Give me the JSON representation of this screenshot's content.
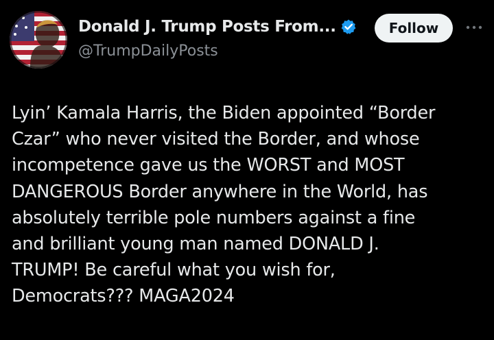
{
  "post": {
    "author": {
      "display_name": "Donald J. Trump Posts From...",
      "handle": "@TrumpDailyPosts",
      "verified": true,
      "avatar_icon": "flag-portrait-avatar"
    },
    "actions": {
      "follow_label": "Follow",
      "more_icon": "ellipsis-icon"
    },
    "text_lines": [
      "Lyin’ Kamala Harris, the Biden appointed “Border",
      "Czar” who never visited the Border, and whose",
      "incompetence gave us the WORST and MOST",
      "DANGEROUS Border anywhere in the World, has",
      "absolutely terrible pole numbers against a fine",
      "and brilliant young man named DONALD J.",
      "TRUMP! Be careful what you wish for,",
      "Democrats??? MAGA2024"
    ]
  },
  "colors": {
    "background": "#000000",
    "text_primary": "#e7e9ea",
    "text_secondary": "#8b9096",
    "verified_blue": "#1d9bf0",
    "follow_bg": "#eff3f4"
  }
}
